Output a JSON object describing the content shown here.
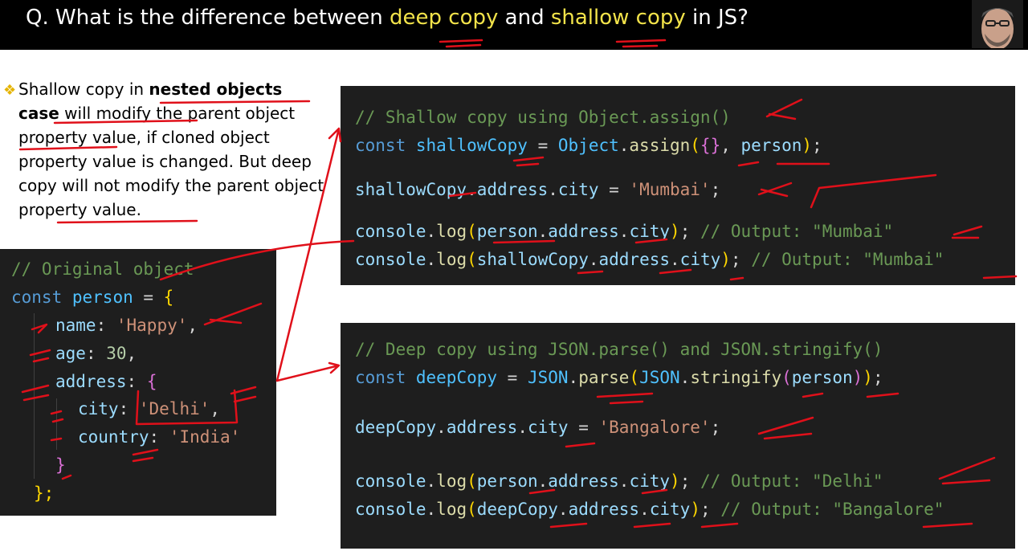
{
  "header": {
    "title_prefix": "Q. What is the difference between ",
    "title_highlight_1": "deep copy",
    "title_mid": " and ",
    "title_highlight_2": "shallow copy",
    "title_suffix": " in JS?"
  },
  "explanation": {
    "bullet_icon": "diamond-bullet-icon",
    "text_1": "Shallow copy in ",
    "bold_1": "nested objects case",
    "text_2": " will modify the parent object property value, if cloned object property value is changed. But deep copy will not modify the parent object property value."
  },
  "original_code": {
    "line1": "// Original object",
    "kw_const": "const",
    "var_person": "person",
    "eq": " = ",
    "open_brace": "{",
    "key_name": "name",
    "val_name": "'Happy'",
    "key_age": "age",
    "val_age": "30",
    "key_address": "address",
    "key_city": "city",
    "val_city": "'Delhi'",
    "key_country": "country",
    "val_country": "'India'",
    "close_inner": "}",
    "close_outer": "};"
  },
  "shallow_code": {
    "comment": "// Shallow copy using Object.assign()",
    "kw_const": "const",
    "var_shallow": "shallowCopy",
    "obj": "Object",
    "fn_assign": "assign",
    "arg_person": "person",
    "assign_lhs_obj": "shallowCopy",
    "path_address": "address",
    "path_city": "city",
    "val_mumbai": "'Mumbai'",
    "console": "console",
    "fn_log": "log",
    "log1_obj": "person",
    "log1_comment": "// Output: \"Mumbai\"",
    "log2_obj": "shallowCopy",
    "log2_comment": "// Output: \"Mumbai\""
  },
  "deep_code": {
    "comment": "// Deep copy using JSON.parse() and JSON.stringify()",
    "kw_const": "const",
    "var_deep": "deepCopy",
    "json": "JSON",
    "fn_parse": "parse",
    "fn_stringify": "stringify",
    "arg_person": "person",
    "assign_lhs_obj": "deepCopy",
    "path_address": "address",
    "path_city": "city",
    "val_bangalore": "'Bangalore'",
    "console": "console",
    "fn_log": "log",
    "log1_obj": "person",
    "log1_comment": "// Output: \"Delhi\"",
    "log2_obj": "deepCopy",
    "log2_comment": "// Output: \"Bangalore\""
  },
  "colors": {
    "title_highlight": "#f2e34a",
    "annotation": "#e0101a",
    "code_bg": "#1e1e1e"
  }
}
